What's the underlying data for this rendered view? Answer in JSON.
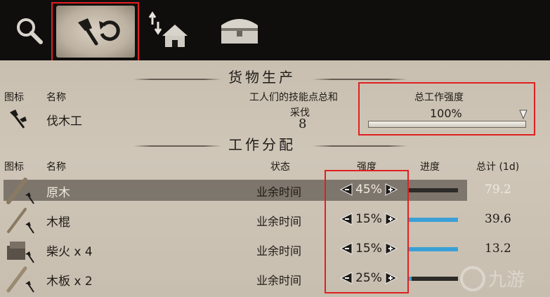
{
  "toolbar": {
    "items": [
      {
        "icon": "magnifier-icon"
      },
      {
        "icon": "axe-repeat-icon",
        "selected": true
      },
      {
        "icon": "house-upgrade-icon"
      },
      {
        "icon": "chest-icon"
      }
    ]
  },
  "production": {
    "title": "货物生产",
    "headers": {
      "icon": "图标",
      "name": "名称",
      "skill": "工人们的技能点总和",
      "intensity": "总工作强度"
    },
    "job": {
      "name": "伐木工",
      "skill_label": "采伐",
      "skill_value": "8",
      "total_intensity": "100%",
      "intensity_fraction": 1.0
    }
  },
  "allocation": {
    "title": "工作分配",
    "headers": {
      "icon": "图标",
      "name": "名称",
      "status": "状态",
      "intensity": "强度",
      "progress": "进度",
      "total": "总计 (1d)"
    },
    "rows": [
      {
        "name": "原木",
        "status": "业余时间",
        "intensity": "45%",
        "progress": 0.0,
        "total": "79.2",
        "highlight": true,
        "icon": "log-icon"
      },
      {
        "name": "木棍",
        "status": "业余时间",
        "intensity": "15%",
        "progress": 1.0,
        "total": "39.6",
        "highlight": false,
        "icon": "stick-icon"
      },
      {
        "name": "柴火 x 4",
        "status": "业余时间",
        "intensity": "15%",
        "progress": 1.0,
        "total": "13.2",
        "highlight": false,
        "icon": "firewood-icon"
      },
      {
        "name": "木板 x 2",
        "status": "业余时间",
        "intensity": "25%",
        "progress": 0.08,
        "total": "",
        "highlight": false,
        "icon": "plank-icon"
      }
    ]
  },
  "watermark": {
    "text": "九游"
  }
}
